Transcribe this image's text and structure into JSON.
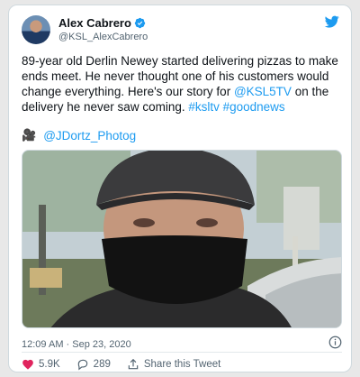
{
  "tweet": {
    "author_name": "Alex Cabrero",
    "handle": "@KSL_AlexCabrero",
    "text_plain": "89-year old Derlin Newey started delivering pizzas to make ends meet. He never thought one of his customers would change everything. Here's our story for ",
    "mention_1": "@KSL5TV",
    "text_mid": " on the delivery he never saw coming. ",
    "hashtag_1": "#ksltv",
    "hashtag_2": "#goodnews",
    "credit_icon": "movie-camera-icon",
    "credit_glyph": "🎥",
    "credit_mention": "@JDortz_Photog",
    "timestamp": "12:09 AM · Sep 23, 2020",
    "likes": "5.9K",
    "replies": "289",
    "share_label": "Share this Tweet"
  },
  "colors": {
    "link": "#1d9bf0",
    "like_red": "#e0245e",
    "muted": "#536471"
  }
}
